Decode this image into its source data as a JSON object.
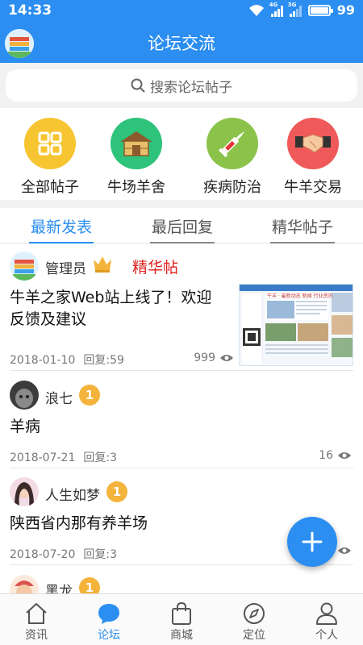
{
  "status": {
    "time": "14:33",
    "net1": "4G",
    "net2": "3G",
    "battery": "99"
  },
  "header": {
    "title": "论坛交流"
  },
  "search": {
    "placeholder": "搜索论坛帖子"
  },
  "categories": [
    {
      "label": "全部帖子",
      "icon": "grid-icon",
      "color": "#f7c531"
    },
    {
      "label": "牛场羊舍",
      "icon": "barn-icon",
      "color": "#2ec37a"
    },
    {
      "label": "疾病防治",
      "icon": "syringe-icon",
      "color": "#8bc34a"
    },
    {
      "label": "牛羊交易",
      "icon": "handshake-icon",
      "color": "#f0595a"
    }
  ],
  "tabs": [
    "最新发表",
    "最后回复",
    "精华帖子"
  ],
  "active_tab": "最新发表",
  "posts": [
    {
      "user": "管理员",
      "badge": "精华帖",
      "title": "牛羊之家Web站上线了！欢迎反馈及建议",
      "date": "2018-01-10",
      "replies": "回复:59",
      "views": "999"
    },
    {
      "user": "浪七",
      "level": "1",
      "title": "羊病",
      "date": "2018-07-21",
      "replies": "回复:3",
      "views": "16"
    },
    {
      "user": "人生如梦",
      "level": "1",
      "title": "陕西省内那有养羊场",
      "date": "2018-07-20",
      "replies": "回复:3",
      "views": ""
    },
    {
      "user": "黑龙",
      "level": "1"
    }
  ],
  "thumbnail_headline": "牛羊 · 最新动态 新闻 行业资讯",
  "bottom_nav": [
    {
      "label": "资讯",
      "icon": "house-icon"
    },
    {
      "label": "论坛",
      "icon": "chat-bubble-icon"
    },
    {
      "label": "商城",
      "icon": "shopping-bag-icon"
    },
    {
      "label": "定位",
      "icon": "compass-icon"
    },
    {
      "label": "个人",
      "icon": "person-icon"
    }
  ],
  "active_nav": "论坛",
  "colors": {
    "primary": "#2b8ef0",
    "badge_red": "#e02020",
    "medal": "#f4b33a",
    "crown": "#f4b33a"
  }
}
